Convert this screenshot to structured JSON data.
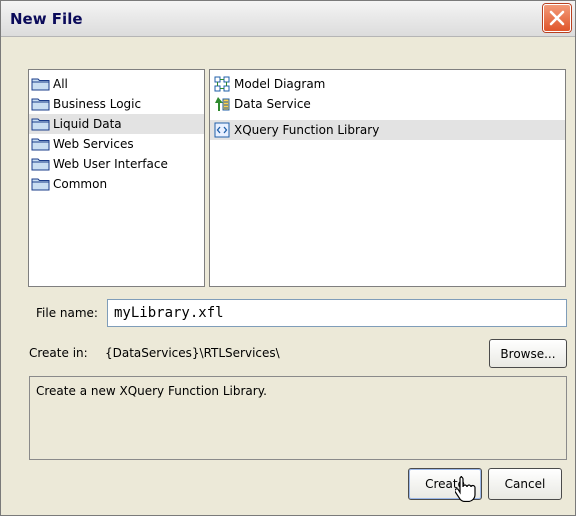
{
  "window": {
    "title": "New File",
    "close_icon": "close-icon"
  },
  "categories": {
    "items": [
      {
        "label": "All",
        "icon": "folder-icon",
        "selected": false
      },
      {
        "label": "Business Logic",
        "icon": "folder-icon",
        "selected": false
      },
      {
        "label": "Liquid Data",
        "icon": "folder-icon",
        "selected": true
      },
      {
        "label": "Web Services",
        "icon": "folder-icon",
        "selected": false
      },
      {
        "label": "Web User Interface",
        "icon": "folder-icon",
        "selected": false
      },
      {
        "label": "Common",
        "icon": "folder-icon",
        "selected": false
      }
    ]
  },
  "file_types": {
    "items": [
      {
        "label": "Model Diagram",
        "icon": "model-diagram-icon",
        "selected": false
      },
      {
        "label": "Data Service",
        "icon": "data-service-icon",
        "selected": false
      },
      {
        "label": "XQuery Function Library",
        "icon": "xquery-library-icon",
        "selected": true
      }
    ]
  },
  "file_name": {
    "label": "File name:",
    "value": "myLibrary.xfl"
  },
  "create_in": {
    "label": "Create in:",
    "path": "{DataServices}\\RTLServices\\"
  },
  "buttons": {
    "browse": "Browse...",
    "create": "Create",
    "cancel": "Cancel"
  },
  "description": "Create a new XQuery Function Library.",
  "colors": {
    "selection": "#e3e3e3",
    "close_button": "#e0552b",
    "dialog_bg": "#ece9d8"
  }
}
